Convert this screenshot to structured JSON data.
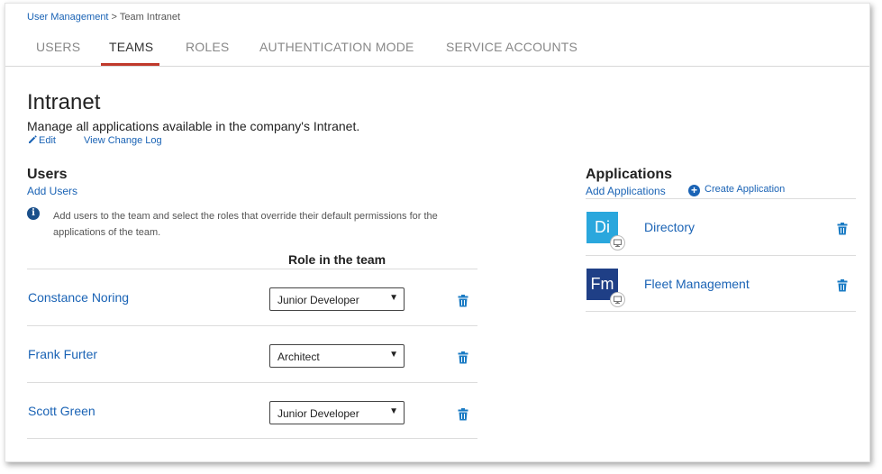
{
  "breadcrumb": {
    "root": "User Management",
    "separator": " > ",
    "current": "Team Intranet"
  },
  "tabs": [
    {
      "label": "USERS",
      "active": false
    },
    {
      "label": "TEAMS",
      "active": true
    },
    {
      "label": "ROLES",
      "active": false
    },
    {
      "label": "AUTHENTICATION  MODE",
      "active": false
    },
    {
      "label": "SERVICE ACCOUNTS",
      "active": false
    }
  ],
  "team": {
    "name": "Intranet",
    "description": "Manage all applications available in the company's Intranet.",
    "edit_label": "Edit",
    "changelog_label": "View Change Log"
  },
  "users_section": {
    "title": "Users",
    "add_label": "Add Users",
    "info_text": "Add users to the team and select the roles that override their default permissions for the applications of the team.",
    "role_column": "Role in the team",
    "rows": [
      {
        "name": "Constance Noring",
        "role": "Junior Developer"
      },
      {
        "name": "Frank Furter",
        "role": "Architect"
      },
      {
        "name": "Scott Green",
        "role": "Junior Developer"
      }
    ]
  },
  "apps_section": {
    "title": "Applications",
    "add_label": "Add Applications",
    "create_label": "Create Application",
    "rows": [
      {
        "initials": "Di",
        "name": "Directory",
        "color": "#2aa7dd"
      },
      {
        "initials": "Fm",
        "name": "Fleet Management",
        "color": "#1f3f86"
      }
    ]
  },
  "colors": {
    "link": "#1a63b5",
    "accent": "#c0392b",
    "trash": "#1a7bc4"
  },
  "icons": {
    "edit": "pencil-icon",
    "info": "info-icon",
    "delete": "trash-icon",
    "create": "plus-circle-icon",
    "badge": "desktop-icon",
    "dropdown": "caret-down-icon"
  }
}
